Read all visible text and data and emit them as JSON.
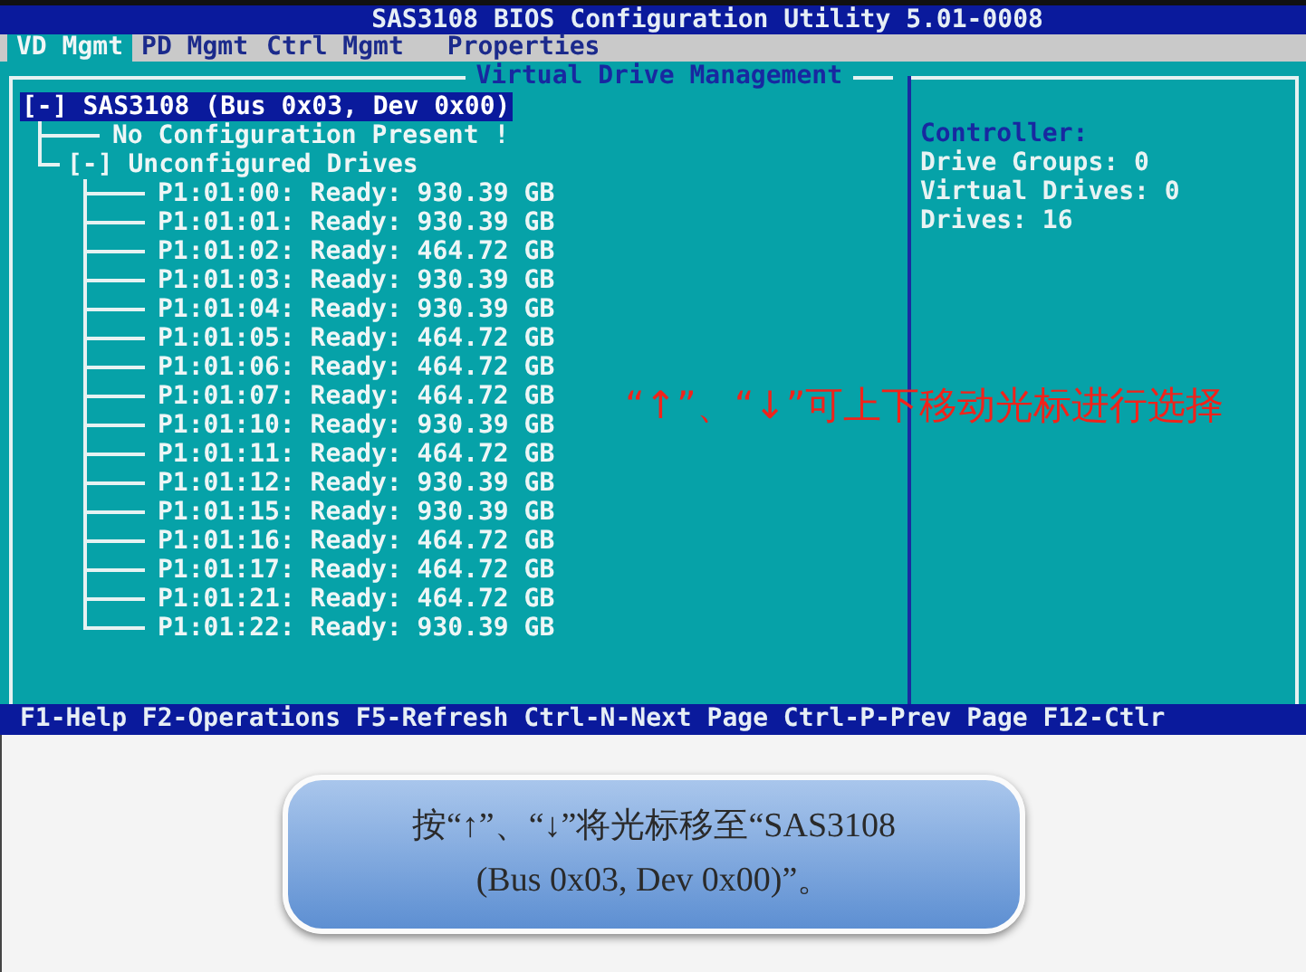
{
  "window": {
    "title": "SAS3108 BIOS Configuration Utility 5.01-0008"
  },
  "tabs": [
    {
      "label": "VD Mgmt",
      "selected": true
    },
    {
      "label": "PD Mgmt",
      "selected": false
    },
    {
      "label": "Ctrl Mgmt",
      "selected": false
    },
    {
      "label": "Properties",
      "selected": false
    }
  ],
  "panel": {
    "title": "Virtual Drive Management"
  },
  "tree": [
    {
      "label": "[-] SAS3108 (Bus 0x03, Dev 0x00)",
      "selected": true,
      "expanded": true,
      "children": [
        {
          "label": "No Configuration Present !",
          "selected": false
        },
        {
          "label": "[-] Unconfigured Drives",
          "selected": false,
          "expanded": true,
          "children": [
            {
              "label": "P1:01:00: Ready: 930.39 GB",
              "selected": false
            },
            {
              "label": "P1:01:01: Ready: 930.39 GB",
              "selected": false
            },
            {
              "label": "P1:01:02: Ready: 464.72 GB",
              "selected": false
            },
            {
              "label": "P1:01:03: Ready: 930.39 GB",
              "selected": false
            },
            {
              "label": "P1:01:04: Ready: 930.39 GB",
              "selected": false
            },
            {
              "label": "P1:01:05: Ready: 464.72 GB",
              "selected": false
            },
            {
              "label": "P1:01:06: Ready: 464.72 GB",
              "selected": false
            },
            {
              "label": "P1:01:07: Ready: 464.72 GB",
              "selected": false
            },
            {
              "label": "P1:01:10: Ready: 930.39 GB",
              "selected": false
            },
            {
              "label": "P1:01:11: Ready: 464.72 GB",
              "selected": false
            },
            {
              "label": "P1:01:12: Ready: 930.39 GB",
              "selected": false
            },
            {
              "label": "P1:01:15: Ready: 930.39 GB",
              "selected": false
            },
            {
              "label": "P1:01:16: Ready: 464.72 GB",
              "selected": false
            },
            {
              "label": "P1:01:17: Ready: 464.72 GB",
              "selected": false
            },
            {
              "label": "P1:01:21: Ready: 464.72 GB",
              "selected": false
            },
            {
              "label": "P1:01:22: Ready: 930.39 GB",
              "selected": false
            }
          ]
        }
      ]
    }
  ],
  "info": {
    "heading": "Controller:",
    "lines": [
      "Drive Groups: 0",
      "Virtual Drives: 0",
      "Drives: 16"
    ]
  },
  "annotation": "“↑”、“↓”可上下移动光标进行选择",
  "status_bar": "F1-Help F2-Operations F5-Refresh Ctrl-N-Next Page Ctrl-P-Prev Page F12-Ctlr",
  "callout": {
    "lines": [
      "按“↑”、“↓”将光标移至“SAS3108",
      "(Bus 0x03, Dev 0x00)”。"
    ]
  }
}
